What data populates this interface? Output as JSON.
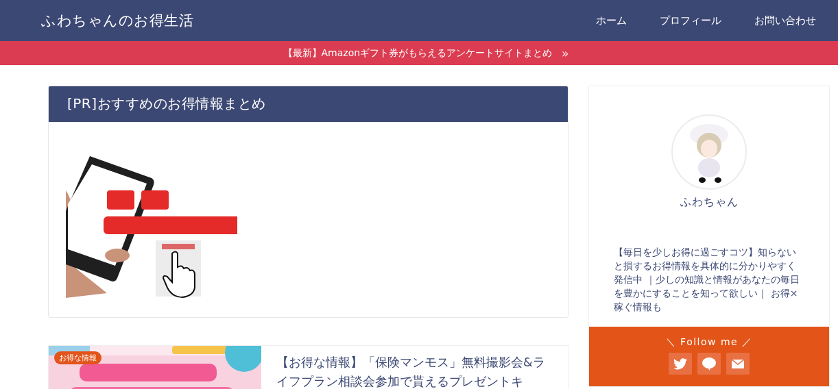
{
  "site": {
    "title": "ふわちゃんのお得生活",
    "nav": [
      {
        "label": "ホーム"
      },
      {
        "label": "プロフィール"
      },
      {
        "label": "お問い合わせ"
      }
    ]
  },
  "notice": {
    "text": "【最新】Amazonギフト券がもらえるアンケートサイトまとめ",
    "arrow": "»"
  },
  "pr_card": {
    "title": "[PR]おすすめのお得情報まとめ"
  },
  "post": {
    "category": "お得な情報",
    "title": "【お得な情報】「保険マンモス」無料撮影会&ライフプラン相談会参加で貰えるプレゼントキ"
  },
  "profile": {
    "name": "ふわちゃん",
    "bio": "【毎日を少しお得に過ごすコツ】知らないと損するお得情報を具体的に分かりやすく発信中 ｜少しの知識と情報があなたの毎日を豊かにすることを知って欲しい｜ お得×稼ぐ情報も",
    "follow_label": "＼ Follow me ／",
    "social": [
      {
        "kind": "twitter"
      },
      {
        "kind": "line"
      },
      {
        "kind": "mail"
      }
    ]
  }
}
